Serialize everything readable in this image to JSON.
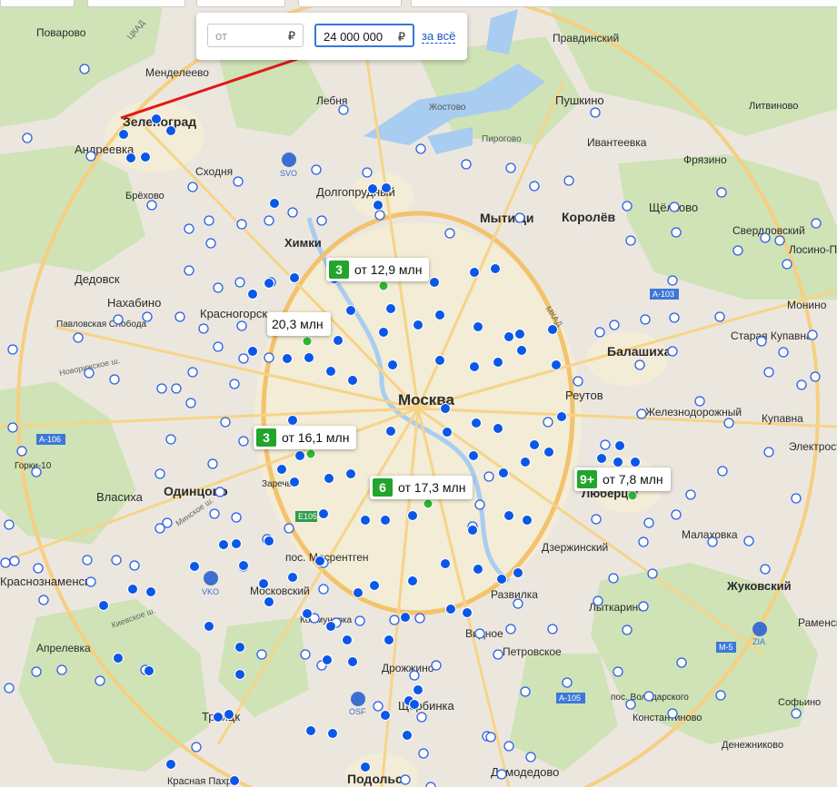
{
  "filter": {
    "from_placeholder": "от",
    "to_value": "24 000 000",
    "currency": "₽",
    "all_link": "за всё"
  },
  "clusters": [
    {
      "count": "3",
      "label": "от 12,9 млн"
    },
    {
      "count": "",
      "label": "20,3 млн"
    },
    {
      "count": "3",
      "label": "от 16,1 млн"
    },
    {
      "count": "6",
      "label": "от 17,3 млн"
    },
    {
      "count": "9+",
      "label": "от 7,8 млн"
    }
  ],
  "places": [
    "Поварово",
    "Менделеево",
    "Лебня",
    "Жостово",
    "Правдинский",
    "Пушкино",
    "Литвиново",
    "Зеленоград",
    "Андреевка",
    "Сходня",
    "Пирогово",
    "Ивантеевка",
    "Фрязино",
    "Брёхово",
    "Долгопрудный",
    "Мытищи",
    "Королёв",
    "Щёлково",
    "Свердловский",
    "Химки",
    "Лосино-Петровский",
    "Дедовск",
    "Нахабино",
    "Красногорск",
    "Монино",
    "Павловская Слобода",
    "Балашиха",
    "Старая Купавна",
    "Москва",
    "Реутов",
    "Железнодорожный",
    "Купавна",
    "Электросталь",
    "Горки-10",
    "Заречье",
    "Люберцы",
    "Власиха",
    "Одинцово",
    "Малаховка",
    "пос. Мосрентген",
    "Дзержинский",
    "Краснознаменск",
    "Московский",
    "Развилка",
    "Жуковский",
    "Лыткарино",
    "Раменское",
    "Коммунарка",
    "Видное",
    "Апрелевка",
    "Петровское",
    "Дрожжино",
    "пос. Володарского",
    "Щербинка",
    "Софьино",
    "Троицк",
    "Константиново",
    "Денежниково",
    "Красная Пахра",
    "Подольск",
    "Домодедово"
  ],
  "roads": [
    "ЦКАД",
    "МКАД",
    "М-5",
    "А-103",
    "А-105",
    "А-106",
    "Е105",
    "Новорижское ш.",
    "Минское ш.",
    "Киевское ш."
  ],
  "airports": [
    "SVO",
    "VKO",
    "OSF",
    "ZIA"
  ],
  "colors": {
    "accent": "#22a52b",
    "pin_blue": "#0b57e8",
    "arrow": "#e2171b",
    "link": "#1a56c0"
  }
}
